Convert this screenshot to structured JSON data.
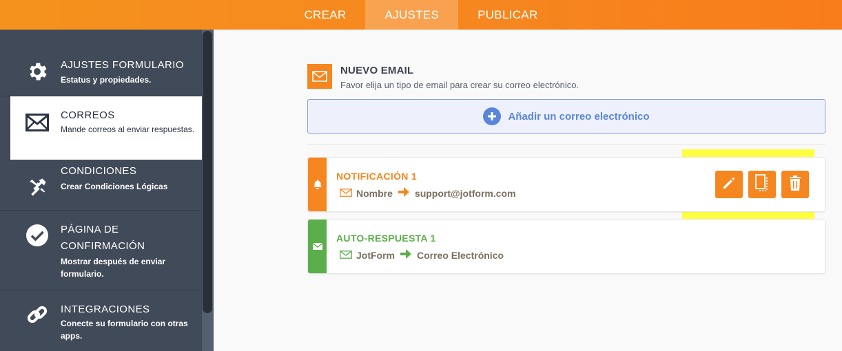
{
  "topbar": {
    "tabs": [
      {
        "label": "CREAR"
      },
      {
        "label": "AJUSTES"
      },
      {
        "label": "PUBLICAR"
      }
    ],
    "active": "AJUSTES"
  },
  "sidebar": {
    "items": [
      {
        "title": "AJUSTES FORMULARIO",
        "desc": "Estatus y propiedades.",
        "icon": "gear-icon"
      },
      {
        "title": "CORREOS",
        "desc": "Mande correos al enviar respuestas.",
        "icon": "envelope-icon"
      },
      {
        "title": "CONDICIONES",
        "desc": "Crear Condiciones Lógicas",
        "icon": "tools-icon"
      },
      {
        "title": "PÁGINA DE CONFIRMACIÓN",
        "desc": "Mostrar después de enviar formulario.",
        "icon": "checkmark-icon"
      },
      {
        "title": "INTEGRACIONES",
        "desc": "Conecte su formulario con otras apps.",
        "icon": "link-icon"
      }
    ],
    "active_index": 1
  },
  "main": {
    "header": {
      "title": "NUEVO EMAIL",
      "desc": "Favor elija un tipo de email para crear su correo electrónico."
    },
    "add_button": {
      "label": "Añadir un correo electrónico"
    },
    "emails": [
      {
        "title": "NOTIFICACIÓN 1",
        "from": "Nombre",
        "to": "support@jotform.com",
        "color": "#f6861f",
        "icon": "bell-icon"
      },
      {
        "title": "AUTO-RESPUESTA 1",
        "from": "JotForm",
        "to": "Correo Electrónico",
        "color": "#5cae4b",
        "icon": "envelope-icon"
      }
    ],
    "actions": [
      {
        "name": "edit-button",
        "icon": "pencil-icon"
      },
      {
        "name": "clone-button",
        "icon": "clone-icon"
      },
      {
        "name": "delete-button",
        "icon": "trash-icon"
      }
    ]
  },
  "colors": {
    "accent": "#f6861f",
    "sidebar": "#414a58",
    "link": "#5a86da",
    "green": "#5cae4b",
    "highlight": "#ffff42"
  }
}
